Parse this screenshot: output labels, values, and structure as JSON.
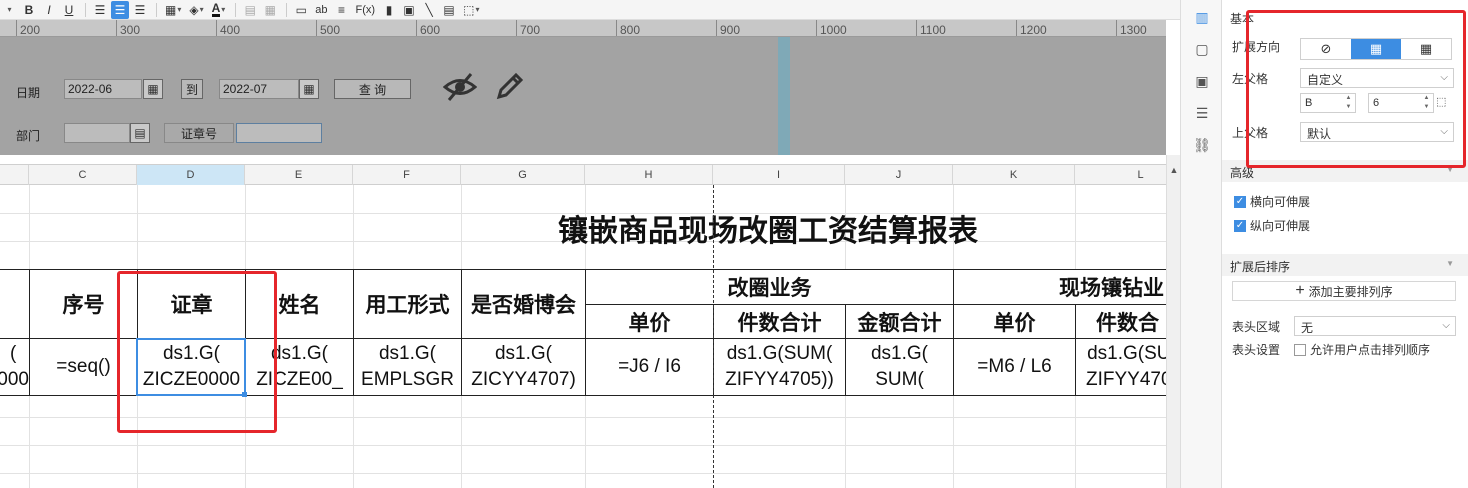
{
  "toolbar": {
    "bold": "B",
    "italic": "I",
    "underline": "U",
    "font_color_glyph": "A",
    "text_glyph": "ab",
    "fx_glyph": "F(x)"
  },
  "ruler": {
    "ticks": [
      "200",
      "300",
      "400",
      "500",
      "600",
      "700",
      "800",
      "900",
      "1000",
      "1100",
      "1200",
      "1300"
    ]
  },
  "params": {
    "date_label": "日期",
    "date_from": "2022-06",
    "to_label": "到",
    "date_to": "2022-07",
    "query_button": "查 询",
    "dept_label": "部门",
    "dept_value": "",
    "seal_label": "证章号",
    "seal_value": ""
  },
  "columns": [
    "C",
    "D",
    "E",
    "F",
    "G",
    "H",
    "I",
    "J",
    "K",
    "L"
  ],
  "report": {
    "title": "镶嵌商品现场改圈工资结算报表",
    "h_seq": "序号",
    "h_seal": "证章",
    "h_name": "姓名",
    "h_type": "用工形式",
    "h_expo": "是否婚博会",
    "h_group1": "改圈业务",
    "h_group2": "现场镶钻业",
    "h_price1": "单价",
    "h_count1": "件数合计",
    "h_amount1": "金额合计",
    "h_price2": "单价",
    "h_count2": "件数合",
    "f_left": "(\n000",
    "f_seq": "=seq()",
    "f_seal": "ds1.G(\nZICZE0000",
    "f_name": "ds1.G(\nZICZE00_",
    "f_type": "ds1.G(\nEMPLSGR",
    "f_expo": "ds1.G(\nZICYY4707)",
    "f_price1": "=J6 / I6",
    "f_count1": "ds1.G(SUM(\nZIFYY4705))",
    "f_amount1": "ds1.G(\nSUM(",
    "f_price2": "=M6 / L6",
    "f_count2": "ds1.G(SU\nZIFYY470"
  },
  "props": {
    "basic_header": "基本",
    "expand_direction_label": "扩展方向",
    "left_parent_label": "左父格",
    "left_parent_value": "自定义",
    "left_parent_col": "B",
    "left_parent_row": "6",
    "top_parent_label": "上父格",
    "top_parent_value": "默认",
    "advanced_header": "高级",
    "horizontal_stretch": "横向可伸展",
    "vertical_stretch": "纵向可伸展",
    "sort_header": "扩展后排序",
    "add_sort_button": "添加主要排列序",
    "header_region_label": "表头区域",
    "header_region_value": "无",
    "header_setting_label": "表头设置",
    "allow_user_sort": "允许用户点击排列顺序"
  },
  "colors": {
    "accent": "#3d8de2",
    "highlight": "#e5262b",
    "param_bg": "#a3a3a3"
  }
}
